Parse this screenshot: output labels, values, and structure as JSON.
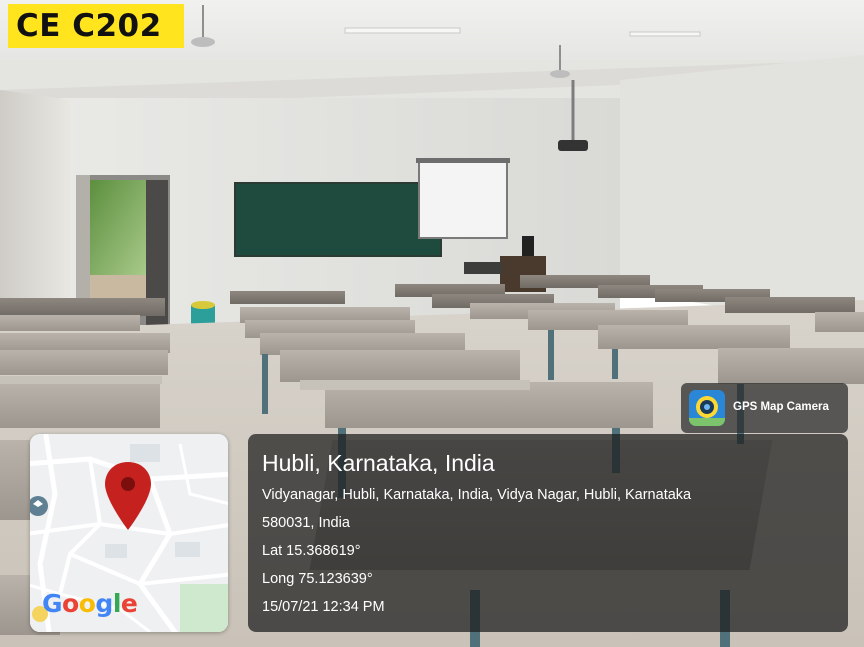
{
  "room_label": "CE C202",
  "info": {
    "city": "Hubli, Karnataka, India",
    "address_line1": "Vidyanagar, Hubli, Karnataka, India, Vidya Nagar, Hubli, Karnataka",
    "address_line2": "580031, India",
    "lat": "Lat 15.368619°",
    "long": "Long 75.123639°",
    "datetime": "15/07/21 12:34 PM"
  },
  "gps_app_name": "GPS Map Camera",
  "map": {
    "pin_color": "#c5221f",
    "logo_text": "Google",
    "road_number": "67"
  },
  "colors": {
    "badge": "#ffe41e",
    "chalkboard": "#1f4a3e",
    "wall": "#e6e5e0"
  }
}
